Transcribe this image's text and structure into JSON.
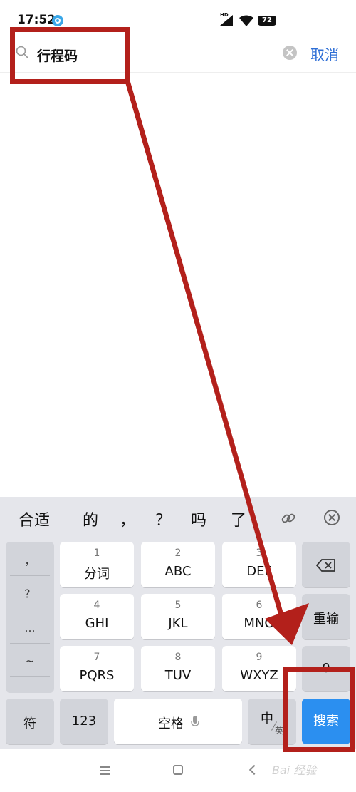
{
  "status": {
    "time": "17:52",
    "network": "HD",
    "battery": "72"
  },
  "search": {
    "query": "行程码",
    "cancel_label": "取消"
  },
  "candidates": [
    "合适",
    "的",
    "，",
    "？",
    "吗",
    "了"
  ],
  "keyboard": {
    "punctuation": [
      "，",
      "？",
      "…",
      "~"
    ],
    "keys": [
      {
        "num": "1",
        "letters": "分词"
      },
      {
        "num": "2",
        "letters": "ABC"
      },
      {
        "num": "3",
        "letters": "DEF"
      },
      {
        "num": "4",
        "letters": "GHI"
      },
      {
        "num": "5",
        "letters": "JKL"
      },
      {
        "num": "6",
        "letters": "MNO"
      },
      {
        "num": "7",
        "letters": "PQRS"
      },
      {
        "num": "8",
        "letters": "TUV"
      },
      {
        "num": "9",
        "letters": "WXYZ"
      }
    ],
    "reenter_label": "重输",
    "zero_label": "0",
    "symbol_label": "符",
    "num_label": "123",
    "space_label": "空格",
    "lang_top": "中",
    "lang_bottom": "英",
    "search_label": "搜索"
  },
  "nav": {
    "watermark": "Bai 经验"
  },
  "colors": {
    "accent": "#2b8ff0",
    "annotation": "#b3201b",
    "cancel": "#2f6fd6"
  }
}
